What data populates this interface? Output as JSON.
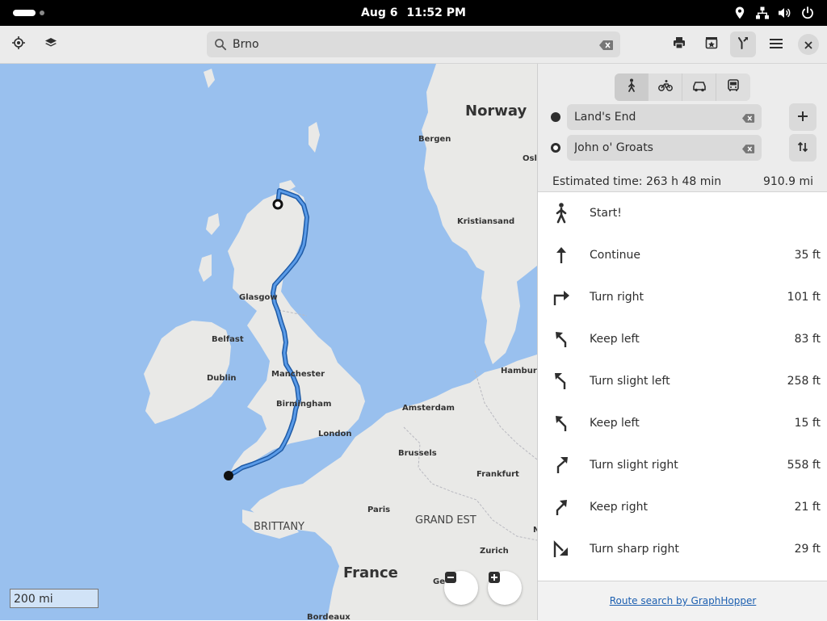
{
  "system_bar": {
    "date": "Aug 6",
    "time": "11:52 PM",
    "tray_icons": [
      "location-icon",
      "network-icon",
      "volume-icon",
      "power-icon"
    ]
  },
  "header": {
    "search_value": "Brno",
    "buttons": [
      "locate-icon",
      "layers-icon",
      "print-icon",
      "favorites-icon",
      "route-icon",
      "menu-icon",
      "close-icon"
    ]
  },
  "map": {
    "labels": {
      "norway": "Norway",
      "bergen": "Bergen",
      "oslo": "Oslo",
      "kristiansand": "Kristiansand",
      "glasgow": "Glasgow",
      "belfast": "Belfast",
      "dublin": "Dublin",
      "manchester": "Manchester",
      "birmingham": "Birmingham",
      "london": "London",
      "hamburg": "Hamburg",
      "amsterdam": "Amsterdam",
      "brussels": "Brussels",
      "frankfurt": "Frankfurt",
      "paris": "Paris",
      "grand_est": "GRAND EST",
      "brittany": "BRITTANY",
      "zurich": "Zurich",
      "france": "France",
      "geneva": "Geneva",
      "bordeaux": "Bordeaux",
      "n_partial": "N"
    },
    "scale": "200 mi",
    "colors": {
      "water": "#99c0ee",
      "land": "#e9e9e7",
      "route": "#3584e4"
    }
  },
  "route": {
    "modes": [
      {
        "name": "walking",
        "active": true
      },
      {
        "name": "cycling",
        "active": false
      },
      {
        "name": "car",
        "active": false
      },
      {
        "name": "transit",
        "active": false
      }
    ],
    "from": "Land's End",
    "to": "John o' Groats",
    "estimated_time": "Estimated time: 263 h 48 min",
    "distance": "910.9 mi",
    "steps": [
      {
        "icon": "walk-icon",
        "text": "Start!",
        "dist": ""
      },
      {
        "icon": "arrow-up-icon",
        "text": "Continue",
        "dist": "35 ft"
      },
      {
        "icon": "turn-right-icon",
        "text": "Turn right",
        "dist": "101 ft"
      },
      {
        "icon": "keep-left-icon",
        "text": "Keep left",
        "dist": "83 ft"
      },
      {
        "icon": "turn-slight-left-icon",
        "text": "Turn slight left",
        "dist": "258 ft"
      },
      {
        "icon": "keep-left-icon",
        "text": "Keep left",
        "dist": "15 ft"
      },
      {
        "icon": "turn-slight-right-icon",
        "text": "Turn slight right",
        "dist": "558 ft"
      },
      {
        "icon": "keep-right-icon",
        "text": "Keep right",
        "dist": "21 ft"
      },
      {
        "icon": "turn-sharp-right-icon",
        "text": "Turn sharp right",
        "dist": "29 ft"
      }
    ],
    "footer_link": "Route search by GraphHopper"
  }
}
